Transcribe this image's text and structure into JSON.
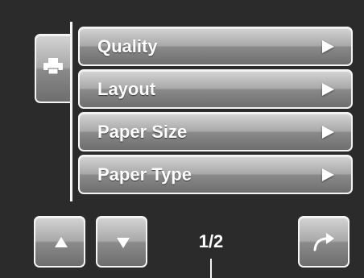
{
  "menu": {
    "items": [
      {
        "label": "Quality"
      },
      {
        "label": "Layout"
      },
      {
        "label": "Paper Size"
      },
      {
        "label": "Paper Type"
      }
    ]
  },
  "side_tab": {
    "icon": "printer-icon"
  },
  "navigation": {
    "up_icon": "up-arrow-icon",
    "down_icon": "down-arrow-icon",
    "page_indicator": "1/2",
    "return_icon": "return-arrow-icon"
  },
  "colors": {
    "background": "#2b2b2b",
    "button_border": "#f4f4f4",
    "button_gradient_top": "#d4d4d4",
    "button_gradient_bottom": "#6e6e6e",
    "text": "#ffffff"
  }
}
